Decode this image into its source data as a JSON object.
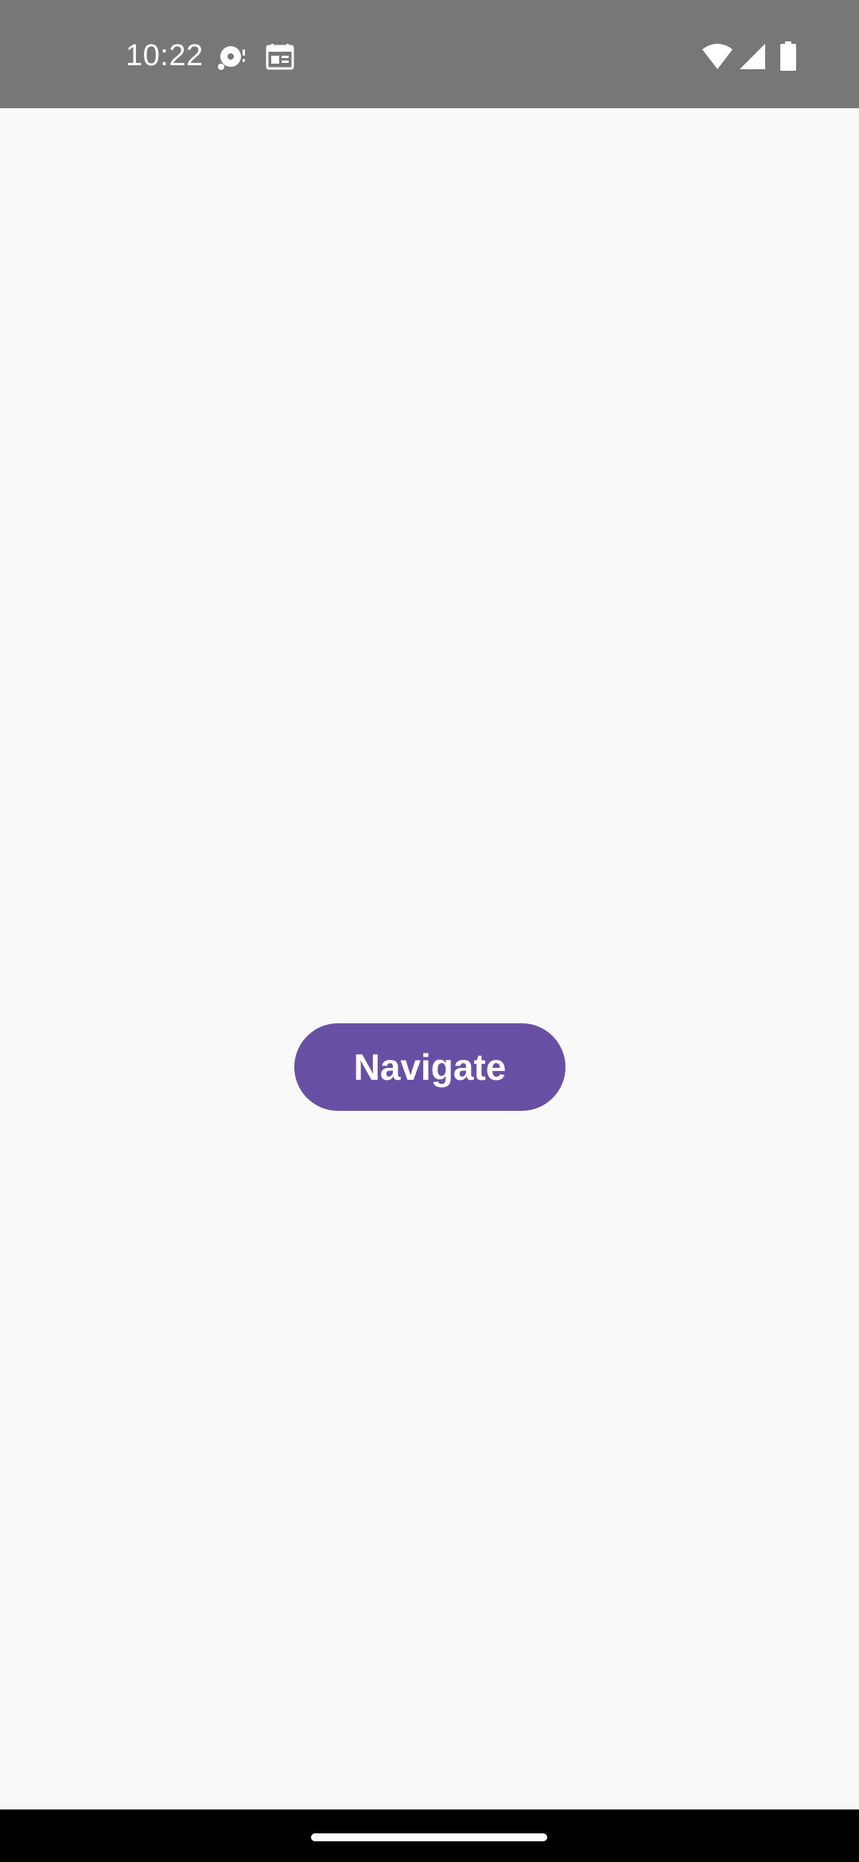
{
  "status_bar": {
    "time": "10:22",
    "background_color": "#777777",
    "left_icons": [
      "media-playback-icon",
      "calendar-icon"
    ],
    "right_icons": [
      "wifi-icon",
      "signal-icon",
      "battery-icon"
    ]
  },
  "main": {
    "navigate_button_label": "Navigate",
    "button_color": "#6750a4",
    "background_color": "#f9f9f9"
  },
  "nav_bar": {
    "handle": "home-gesture-handle"
  }
}
